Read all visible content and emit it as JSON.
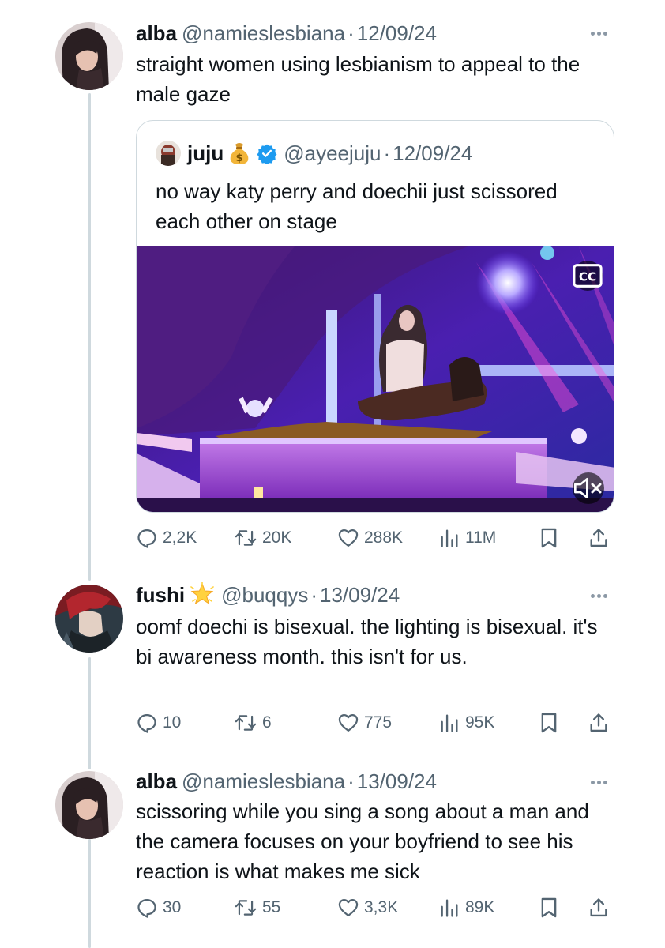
{
  "tweets": [
    {
      "name": "alba",
      "handle": "@namieslesbiana",
      "separator": "·",
      "date": "12/09/24",
      "text": "straight women using lesbianism to appeal to the male gaze",
      "quote": {
        "name": "juju",
        "emoji_badge": "money-bag-emoji",
        "verified": true,
        "handle": "@ayeejuju",
        "separator": "·",
        "date": "12/09/24",
        "text": "no way katy perry and doechii just scissored each other on stage",
        "media": {
          "type": "video",
          "cc_label": "CC",
          "muted": true,
          "colors": {
            "purple": "#7b22d8",
            "magenta": "#e23cc8",
            "blue": "#2c2f9c"
          }
        }
      },
      "stats": {
        "replies": "2,2K",
        "reposts": "20K",
        "likes": "288K",
        "views": "11M"
      }
    },
    {
      "name": "fushi",
      "emoji_badge": "glowing-star-emoji",
      "handle": "@buqqys",
      "separator": "·",
      "date": "13/09/24",
      "text": "oomf doechi is bisexual. the lighting is bisexual. it's bi awareness month. this isn't for us.",
      "stats": {
        "replies": "10",
        "reposts": "6",
        "likes": "775",
        "views": "95K"
      }
    },
    {
      "name": "alba",
      "handle": "@namieslesbiana",
      "separator": "·",
      "date": "13/09/24",
      "text": "scissoring while you sing a song about a man and the camera focuses on your boyfriend to see his reaction is what makes me sick",
      "stats": {
        "replies": "30",
        "reposts": "55",
        "likes": "3,3K",
        "views": "89K"
      }
    }
  ],
  "colors": {
    "text": "#0f1419",
    "secondary": "#536471",
    "thread_line": "#cfd9de",
    "verified": "#1d9bf0"
  },
  "icons": [
    "reply-icon",
    "repost-icon",
    "like-icon",
    "views-icon",
    "bookmark-icon",
    "share-icon",
    "more-icon",
    "verified-icon",
    "cc-icon",
    "mute-icon"
  ]
}
